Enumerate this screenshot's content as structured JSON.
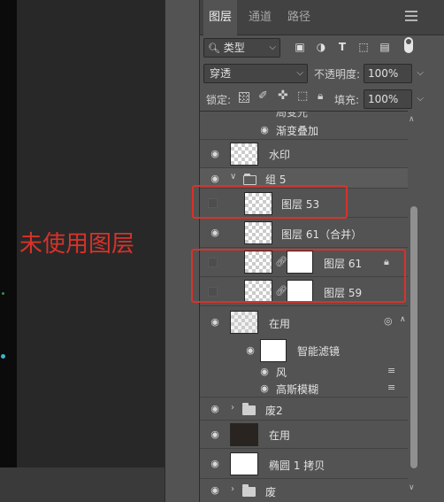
{
  "tabs": [
    {
      "label": "图层",
      "active": true
    },
    {
      "label": "通道",
      "active": false
    },
    {
      "label": "路径",
      "active": false
    }
  ],
  "filter": {
    "search_icon": "search-icon",
    "value": "类型",
    "icons": [
      "image-icon",
      "circle-half-icon",
      "text-icon",
      "transform-icon",
      "smart-object-icon"
    ]
  },
  "blend": {
    "mode": "穿透",
    "opacity_label": "不透明度:",
    "opacity": "100%"
  },
  "lock": {
    "label": "锁定:",
    "icons": [
      "lock-transparent-icon",
      "brush-icon",
      "move-icon",
      "artboard-icon",
      "lock-icon"
    ],
    "fill_label": "填充:",
    "fill": "100%"
  },
  "layers": [
    {
      "name": "局变光",
      "visible": true,
      "type": "effect-cut"
    },
    {
      "name": "渐变叠加",
      "visible": true,
      "type": "effect"
    },
    {
      "name": "水印",
      "visible": true,
      "type": "layer"
    },
    {
      "name": "组 5",
      "visible": true,
      "type": "group-open"
    },
    {
      "name": "图层 53",
      "visible": false,
      "type": "layer"
    },
    {
      "name": "图层 61（合并）",
      "visible": true,
      "type": "layer"
    },
    {
      "name": "图层 61",
      "visible": false,
      "type": "masked",
      "locked": true
    },
    {
      "name": "图层 59",
      "visible": false,
      "type": "masked"
    },
    {
      "name": "在用",
      "visible": true,
      "type": "smart"
    },
    {
      "name": "智能滤镜",
      "visible": true,
      "type": "filter-mask"
    },
    {
      "name": "风",
      "visible": true,
      "type": "filter"
    },
    {
      "name": "高斯模糊",
      "visible": true,
      "type": "filter"
    },
    {
      "name": "废2",
      "visible": true,
      "type": "group"
    },
    {
      "name": "在用",
      "visible": true,
      "type": "image"
    },
    {
      "name": "椭圆 1 拷贝",
      "visible": true,
      "type": "shape"
    },
    {
      "name": "废",
      "visible": true,
      "type": "group"
    }
  ],
  "annotation": "未使用图层",
  "colors": {
    "panel": "#535353",
    "tabbar": "#424242",
    "highlight_red": "#d8322a"
  }
}
